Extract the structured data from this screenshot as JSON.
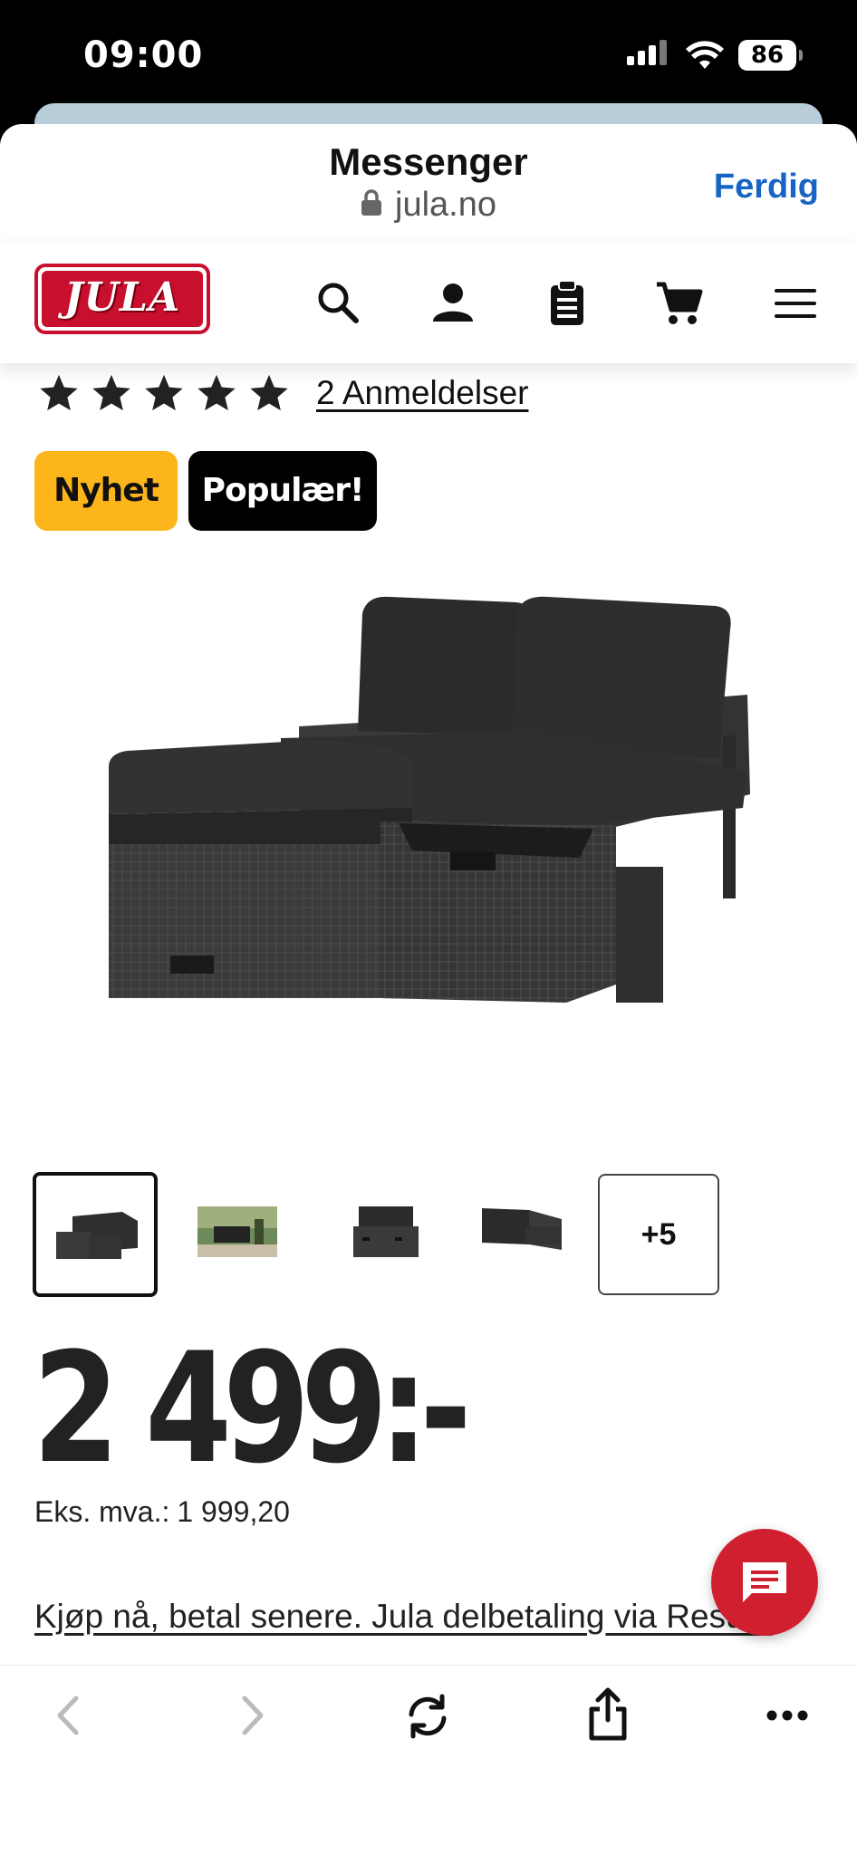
{
  "status_bar": {
    "time": "09:00",
    "battery": "86"
  },
  "browser": {
    "title": "Messenger",
    "url": "jula.no",
    "done_label": "Ferdig"
  },
  "header": {
    "logo_text": "JULA",
    "icons": [
      "search-icon",
      "account-icon",
      "clipboard-icon",
      "cart-icon",
      "menu-icon"
    ],
    "brand_color": "#c8102e"
  },
  "product": {
    "rating": {
      "stars": 5,
      "max": 5
    },
    "reviews_label": "2 Anmeldelser",
    "badges": [
      {
        "label": "Nyhet",
        "color": "#fcb51a"
      },
      {
        "label": "Populær!",
        "color": "#000000"
      }
    ],
    "thumbnail_more_label": "+5",
    "price": "2 499:-",
    "ex_vat_label": "Eks. mva.:",
    "ex_vat_value": "1 999,20",
    "payment_link": "Kjøp nå, betal senere. Jula delbetaling via Resurs"
  },
  "toolbar": {
    "icons": [
      "back-icon",
      "forward-icon",
      "reload-icon",
      "share-icon",
      "more-icon"
    ]
  }
}
